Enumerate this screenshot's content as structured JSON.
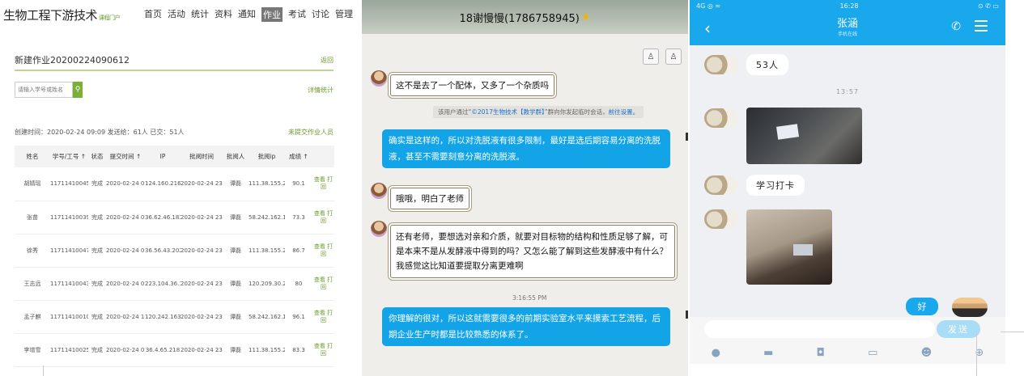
{
  "panel1": {
    "brand": "生物工程下游技术",
    "brand_tag": "课程门户",
    "nav": [
      "首页",
      "活动",
      "统计",
      "资料",
      "通知",
      "作业",
      "考试",
      "讨论",
      "管理"
    ],
    "nav_active_index": 5,
    "title": "新建作业20200224090612",
    "back": "返回",
    "search_placeholder": "请输入学号或姓名",
    "detail_stats": "详情统计",
    "meta_created": "创建时间：2020-02-24 09:09  发送给：61人  已交：51人",
    "unsubmitted": "未提交作业人员",
    "headers": [
      "姓名",
      "学号/工号 ↑",
      "状态",
      "提交时间 ↑",
      "IP",
      "批阅时间",
      "批阅人",
      "批阅ip",
      "成绩 ↑",
      ""
    ],
    "rows": [
      [
        "胡婧瑶",
        "11711410045",
        "完成",
        "2020-02-24 09:28",
        "124.160.216.224",
        "2020-02-24 23:01",
        "谭磊",
        "111.38.155.27",
        "90.1",
        "查看 打回"
      ],
      [
        "张苗",
        "11711410039",
        "完成",
        "2020-02-24 09:31",
        "36.62.46.183",
        "2020-02-24 23:03",
        "谭磊",
        "58.242.162.133",
        "73.3",
        "查看 打回"
      ],
      [
        "徐秀",
        "11711410047",
        "完成",
        "2020-02-24 09:24",
        "36.56.43.202",
        "2020-02-24 23:03",
        "谭磊",
        "111.38.155.27",
        "86.7",
        "查看 打回"
      ],
      [
        "王志远",
        "11711410043",
        "完成",
        "2020-02-24 09:28",
        "223.104.36.12",
        "2020-02-24 23:04",
        "谭磊",
        "120.209.30.28",
        "80",
        "查看 打回"
      ],
      [
        "孟子麒",
        "11711410010",
        "完成",
        "2020-02-24 10:39",
        "120.242.163.79",
        "2020-02-24 23:04",
        "谭磊",
        "58.242.162.133",
        "96.1",
        "查看 打回"
      ],
      [
        "李增雪",
        "11711410025",
        "完成",
        "2020-02-24 09:24",
        "36.4.65.218",
        "2020-02-24 23:05",
        "谭磊",
        "111.38.155.27",
        "83.3",
        "查看 打回"
      ]
    ]
  },
  "panel2": {
    "title": "18谢慢慢(1786758945)",
    "tool_icons": [
      "group-members-icon",
      "add-member-icon"
    ],
    "msg1": "这不是去了一个配体，又多了一个杂质吗",
    "sys_prefix": "该用户通过“",
    "sys_group": "©2017生物技术【教学群】",
    "sys_mid": "”群向你发起临时会话，",
    "sys_link": "前往设置。",
    "reply1": "确实是这样的，所以对洗脱液有很多限制，最好是选后期容易分离的洗脱液，甚至不需要刻意分离的洗脱液。",
    "msg2": "哦哦，明白了老师",
    "msg3": "还有老师，要想选对亲和介质，就要对目标物的结构和性质足够了解，可是本来不是从发酵液中得到的吗？又怎么能了解到这些发酵液中有什么？我感觉这比知道要提取分离更难啊",
    "time": "3:16:55 PM",
    "reply2": "你理解的很对，所以这就需要很多的前期实验室水平来摸索工艺流程，后期企业生产时都是比较熟悉的体系了。"
  },
  "panel3": {
    "status_left": "4G ◎ ≈",
    "status_time": "16:28",
    "status_right": "⊙ ✆ ▭",
    "contact": "张涵",
    "contact_status": "手机在线",
    "msg1": "53人",
    "time": "13:57",
    "msg2": "学习打卡",
    "reply": "好",
    "send": "发送",
    "bottom_icons": [
      "mic-icon",
      "image-icon",
      "camera-icon",
      "red-packet-icon",
      "emoji-icon",
      "plus-icon"
    ]
  }
}
